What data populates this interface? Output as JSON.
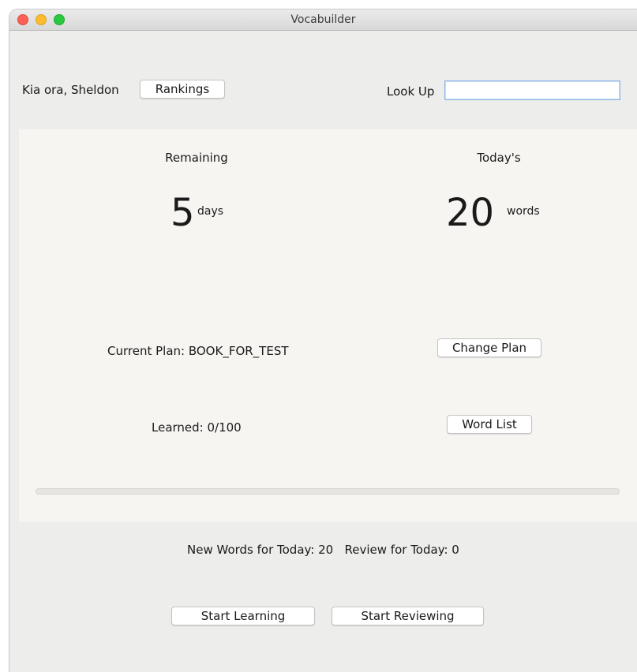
{
  "window": {
    "title": "Vocabuilder"
  },
  "header": {
    "greeting": "Kia ora, Sheldon",
    "rankings_label": "Rankings",
    "lookup_label": "Look Up",
    "lookup_value": ""
  },
  "panel": {
    "remaining_label": "Remaining",
    "remaining_value": "5",
    "remaining_unit": "days",
    "todays_label": "Today's",
    "todays_value": "20",
    "todays_unit": "words",
    "current_plan": "Current Plan: BOOK_FOR_TEST",
    "change_plan_label": "Change Plan",
    "learned": "Learned: 0/100",
    "word_list_label": "Word List",
    "progress_fraction": 0
  },
  "footer": {
    "stats": "New Words for Today: 20   Review for Today: 0",
    "start_learning_label": "Start Learning",
    "start_reviewing_label": "Start Reviewing"
  },
  "colors": {
    "accent": "#3b82f6",
    "close": "#fc5f57",
    "minimize": "#fdbc2e",
    "maximize": "#28c840"
  }
}
